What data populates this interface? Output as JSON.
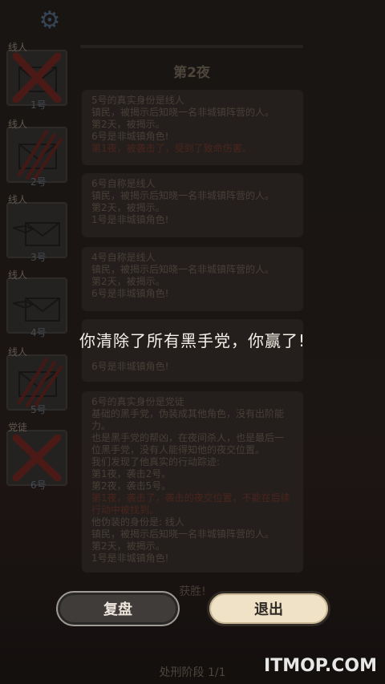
{
  "game": {
    "night_title": "第2夜",
    "phase": "处刑阶段 1/1",
    "win_text_faded": "获胜!"
  },
  "players": [
    {
      "role": "线人",
      "number": "1号",
      "state": "dead"
    },
    {
      "role": "线人",
      "number": "2号",
      "state": "clawed"
    },
    {
      "role": "线人",
      "number": "3号",
      "state": "alive"
    },
    {
      "role": "线人",
      "number": "4号",
      "state": "alive"
    },
    {
      "role": "线人",
      "number": "5号",
      "state": "clawed"
    },
    {
      "role": "党徒",
      "number": "6号",
      "state": "dead"
    }
  ],
  "log_cards": [
    {
      "lines": [
        "5号的真实身份是线人",
        "镇民，被揭示后知晓一名非城镇阵营的人。",
        "第2天，被揭示。",
        "6号是非城镇角色!"
      ],
      "red_lines": [
        "第1夜，被袭击了，受到了致命伤害。"
      ]
    },
    {
      "lines": [
        "6号自称是线人",
        "镇民，被揭示后知晓一名非城镇阵营的人。",
        "第2天，被揭示。",
        "1号是非城镇角色!"
      ],
      "red_lines": []
    },
    {
      "lines": [
        "4号自称是线人",
        "镇民，被揭示后知晓一名非城镇阵营的人。",
        "第2天，被揭示。",
        "6号是非城镇角色!"
      ],
      "red_lines": []
    },
    {
      "lines": [
        "6号是非城镇角色!"
      ],
      "red_lines": []
    },
    {
      "lines": [
        "6号的真实身份是党徒",
        "基础的黑手党，伪装成其他角色，没有出阶能",
        "力。",
        "也是黑手党的帮凶，在夜间杀人，也是最后一",
        "位黑手党，没有人能得知他的夜交位置。",
        "我们发现了他真实的行动踪迹:",
        "第1夜，袭击2号。",
        "第2夜，袭击5号。"
      ],
      "red_lines": [
        "第1夜，袭击了，袭击的夜交位置，不能在后续行动中被找到。"
      ],
      "tail_lines": [
        "他伪装的身份是: 线人",
        "镇民，被揭示后知晓一名非城镇阵营的人。",
        "第2天，被揭示。",
        "1号是非城镇角色!"
      ]
    }
  ],
  "overlay": {
    "message": "你清除了所有黑手党，你赢了!",
    "replay_label": "复盘",
    "exit_label": "退出"
  },
  "watermark": "ITMOP.COM",
  "colors": {
    "accent_red": "#7a3a30",
    "exit_bg": "#efe2c6",
    "replay_bg": "#3f3c3a"
  },
  "icons": [
    "gear-icon",
    "envelope-icon",
    "cross-icon",
    "claw-icon"
  ]
}
